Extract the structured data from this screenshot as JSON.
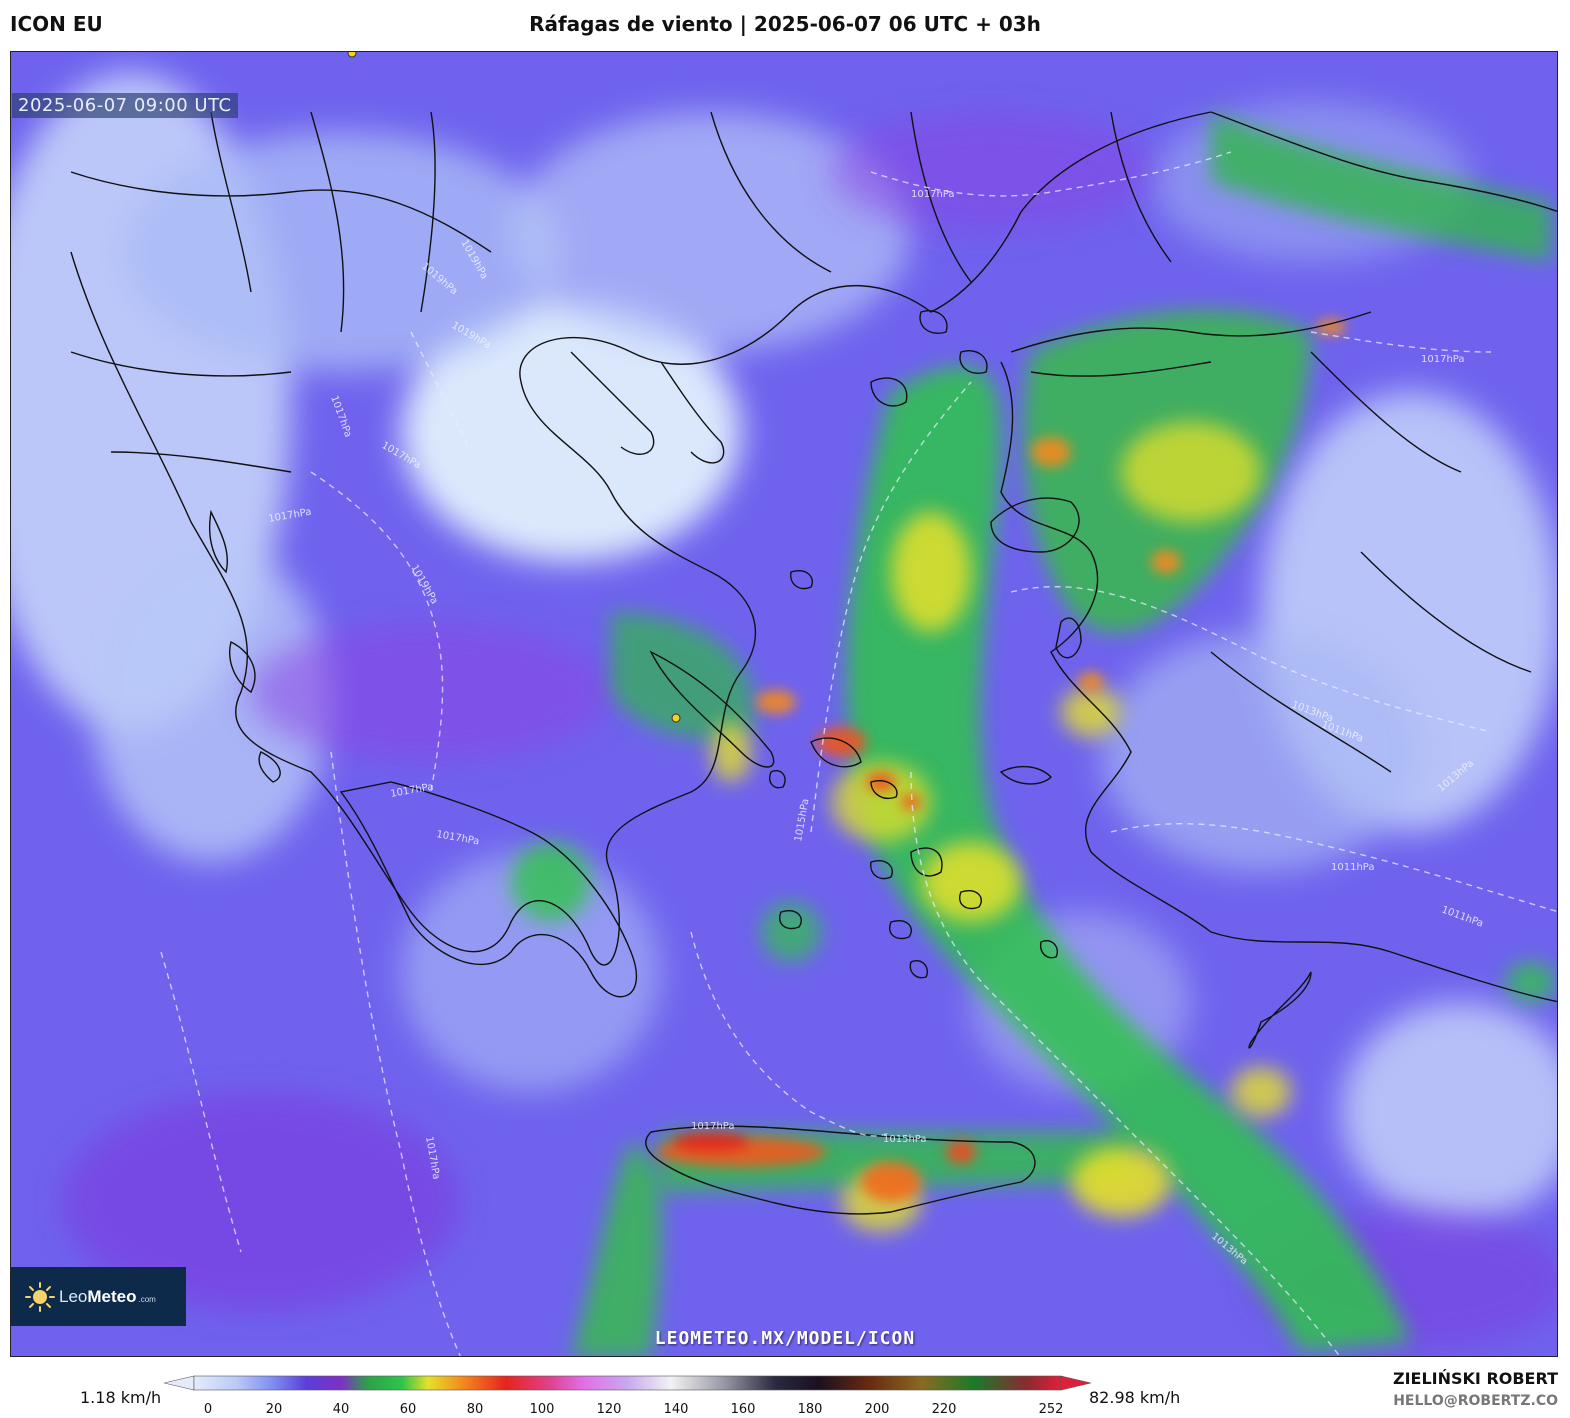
{
  "header": {
    "model": "ICON EU",
    "title": "Ráfagas de viento | 2025-06-07 06 UTC + 03h"
  },
  "map": {
    "timestamp": "2025-06-07 09:00 UTC",
    "watermark": "LEOMETEO.MX/MODEL/ICON",
    "isobar_labels": [
      "1017hPa",
      "1019hPa",
      "1019hPa",
      "1019hPa",
      "1017hPa",
      "1017hPa",
      "1019hPa",
      "1017hPa",
      "1017hPa",
      "1015hPa",
      "1013hPa",
      "1013hPa",
      "1011hPa",
      "1011hPa",
      "1017hPa",
      "1017hPa",
      "1015hPa",
      "1017hPa",
      "1013hPa",
      "1017hPa",
      "1011hPa"
    ],
    "colors": {
      "calm": "#d8e6fb",
      "light": "#8fa6f4",
      "moderate": "#6a52e6",
      "purple": "#8a3ad8",
      "green": "#2fc44a",
      "yellow": "#e6e02a",
      "orange": "#f28a1c",
      "red": "#e6241e"
    }
  },
  "logo": {
    "brand_light": "Leo",
    "brand_bold": "Meteo",
    "brand_suffix": ".com"
  },
  "legend": {
    "min_label": "1.18 km/h",
    "max_label": "82.98 km/h",
    "ticks": [
      "0",
      "20",
      "40",
      "60",
      "80",
      "100",
      "120",
      "140",
      "160",
      "180",
      "200",
      "220",
      "252"
    ]
  },
  "author": {
    "name": "ZIELIŃSKI ROBERT",
    "email": "HELLO@ROBERTZ.CO"
  }
}
